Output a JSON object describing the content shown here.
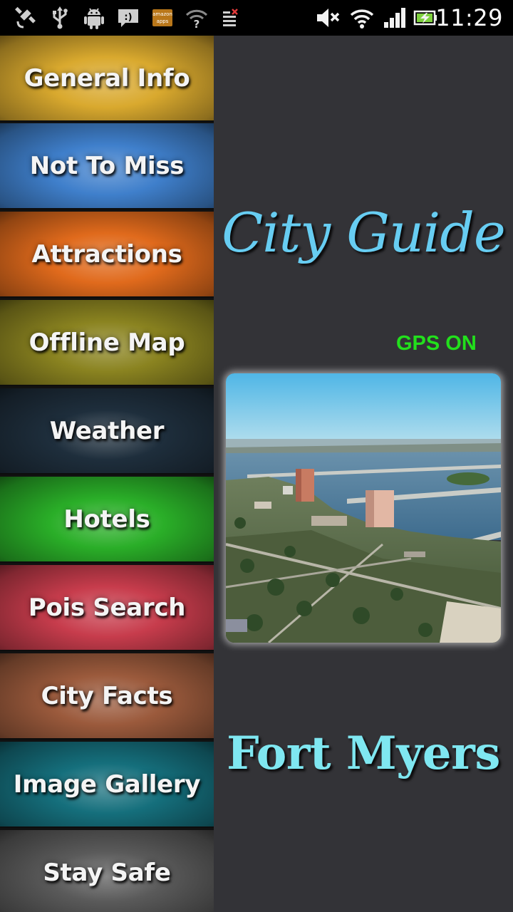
{
  "status_bar": {
    "time": "11:29",
    "left_icons": [
      "gps-icon",
      "usb-icon",
      "android-debug-icon",
      "message-icon",
      "amazon-appstore-icon",
      "wifi-unknown-icon",
      "notification-icon"
    ],
    "right_icons": [
      "mute-icon",
      "wifi-icon",
      "signal-icon",
      "battery-charging-icon"
    ],
    "amazon_text_top": "amazon",
    "amazon_text_bottom": "apps"
  },
  "menu": {
    "items": [
      {
        "label": "General Info",
        "color": "#d9a92e"
      },
      {
        "label": "Not To Miss",
        "color": "#3f7fcb"
      },
      {
        "label": "Attractions",
        "color": "#e06a1c"
      },
      {
        "label": "Offline Map",
        "color": "#8a8320"
      },
      {
        "label": "Weather",
        "color": "#1e2e3c"
      },
      {
        "label": "Hotels",
        "color": "#2aae28"
      },
      {
        "label": "Pois Search",
        "color": "#c73c4c"
      },
      {
        "label": "City Facts",
        "color": "#9b5a3c"
      },
      {
        "label": "Image Gallery",
        "color": "#156f7c"
      },
      {
        "label": "Stay Safe",
        "color": "#5a5a5a"
      }
    ]
  },
  "panel": {
    "title": "City Guide",
    "gps_status": "GPS ON",
    "city_name": "Fort Myers",
    "photo": "aerial-city-photo",
    "background_color": "#333337",
    "title_color": "#67cdf2",
    "gps_color": "#22e01c",
    "city_color": "#7fe7f1"
  }
}
